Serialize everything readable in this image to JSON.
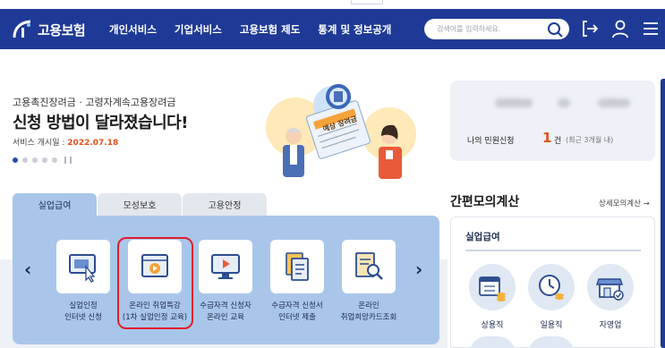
{
  "header": {
    "logo_text": "고용보험",
    "nav": [
      "개인서비스",
      "기업서비스",
      "고용보험 제도",
      "통계 및 정보공개"
    ],
    "search_placeholder": "검색어를 입력하세요."
  },
  "hero": {
    "subtitle": "고용촉진장려금 · 고령자계속고용장려금",
    "title": "신청 방법이 달라졌습니다!",
    "date_label": "서비스 개시일 : ",
    "date_value": "2022.07.18",
    "illustration_text": "예상 장려금"
  },
  "my_civil": {
    "label": "나의 민원신청",
    "count": "1",
    "unit": "건",
    "range": "(최근 3개월 내)"
  },
  "service_tabs": [
    "실업급여",
    "모성보호",
    "고용안정"
  ],
  "services": [
    {
      "line1": "실업인정",
      "line2": "인터넷 신청"
    },
    {
      "line1": "온라인 취업특강",
      "line2": "(1차 실업인정 교육)"
    },
    {
      "line1": "수급자격 신청자",
      "line2": "온라인 교육"
    },
    {
      "line1": "수급자격 신청서",
      "line2": "인터넷 제출"
    },
    {
      "line1": "온라인",
      "line2": "취업희망카드조회"
    }
  ],
  "calc": {
    "title": "간편모의계산",
    "more": "상세모의계산 →",
    "tab": "실업급여",
    "items": [
      "상용직",
      "일용직",
      "자영업"
    ]
  },
  "colors": {
    "header_bg": "#1f3a96",
    "panel_bg": "#a9c6ea",
    "highlight": "#e11d2a",
    "accent_orange": "#e2501c"
  }
}
